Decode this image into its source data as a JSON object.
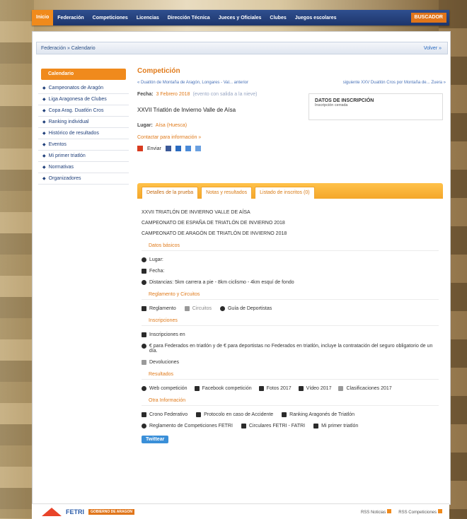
{
  "colors": {
    "nav_bg": "#1d356b",
    "accent": "#f08a1c",
    "link": "#1f3f7a",
    "tab_bar": "#f4a62a"
  },
  "topnav": {
    "items": [
      {
        "label": "Inicio",
        "active": true
      },
      {
        "label": "Federación",
        "active": false
      },
      {
        "label": "Competiciones",
        "active": false
      },
      {
        "label": "Licencias",
        "active": false
      },
      {
        "label": "Dirección Técnica",
        "active": false
      },
      {
        "label": "Jueces y Oficiales",
        "active": false
      },
      {
        "label": "Clubes",
        "active": false
      },
      {
        "label": "Juegos escolares",
        "active": false
      }
    ],
    "right_tag": "BUSCADOR"
  },
  "breadcrumb": {
    "text": "Federación » Calendario",
    "back": "Volver »"
  },
  "sidebar": {
    "header": "Calendario",
    "items": [
      {
        "label": "Campeonatos de Aragón"
      },
      {
        "label": "Liga Aragonesa de Clubes"
      },
      {
        "label": "Copa Arag. Duatlón Cros"
      },
      {
        "label": "Ranking individual"
      },
      {
        "label": "Histórico de resultados"
      },
      {
        "label": "Eventos"
      },
      {
        "label": "Mi primer triatlón"
      },
      {
        "label": "Normativas"
      },
      {
        "label": "Organizadores"
      }
    ]
  },
  "main": {
    "title": "Competición",
    "prev": "« Duatlón de Montaña de Aragón, Longares - Val... anterior",
    "next": "siguiente XXV Duatlón Cros por Montaña de... Zuera »",
    "date_label": "Fecha:",
    "date_value": "3 Febrero 2018",
    "date_note": "(evento con salida a la nieve)",
    "event_name": "XXVII Triatlón de Invierno Valle de Aísa",
    "place_label": "Lugar:",
    "place_value": "Aísa (Huesca)",
    "contact": "Contactar para información »",
    "share_label": "Enviar",
    "inscription": {
      "title": "DATOS DE INSCRIPCIÓN",
      "subtitle": "Inscripción cerrada"
    }
  },
  "tabs": [
    {
      "label": "Detalles de la prueba",
      "selected": true
    },
    {
      "label": "Notas y resultados",
      "selected": false
    },
    {
      "label": "Listado de inscritos (0)",
      "selected": false
    }
  ],
  "details": {
    "lines": [
      "XXVII TRIATLÓN DE INVIERNO VALLE DE AÍSA",
      "CAMPEONATO DE ESPAÑA DE TRIATLÓN DE INVIERNO 2018",
      "CAMPEONATO DE ARAGÓN DE TRIATLÓN DE INVIERNO 2018"
    ],
    "sec_general": "Datos básicos",
    "lugar": "Lugar:",
    "fecha": "Fecha:",
    "distancias": "Distancias: 5km carrera a pie - 8km ciclismo - 4km esquí de fondo",
    "sec_reglamento": "Reglamento y Circuitos",
    "reglamento": "Reglamento",
    "circuitos": "Circuitos",
    "guia": "Guía de Deportistas",
    "sec_inscripciones": "Inscripciones",
    "inscripciones": "Inscripciones en",
    "precio": "€ para Federados en triatlón y de € para deportistas no Federados en triatlón, incluye la contratación del seguro obligatorio de un día.",
    "devoluciones": "Devoluciones",
    "sec_resultados": "Resultados",
    "res_items": [
      "Web competición",
      "Facebook competición",
      "Fotos 2017",
      "Vídeo 2017",
      "Clasificaciones 2017"
    ],
    "sec_otra": "Otra Información",
    "otra_items": [
      "Crono Federativo",
      "Protocolo en caso de Accidente",
      "Ranking Aragonés de Triatlón"
    ],
    "otra_items2": [
      "Reglamento de Competiciones FETRI",
      "Circulares FETRI - FATRI",
      "Mi primer triatlón"
    ],
    "tweet": "Twittear"
  },
  "footer": {
    "fetri": "FETRI",
    "aragon": "GOBIERNO DE ARAGON",
    "rss1": "RSS Noticias",
    "rss2": "RSS Competiciones"
  }
}
